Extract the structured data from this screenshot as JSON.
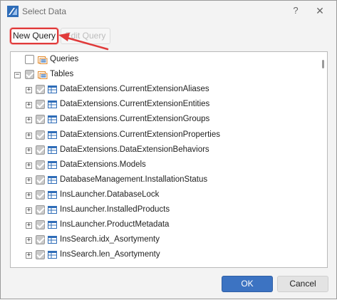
{
  "window": {
    "title": "Select Data",
    "help_glyph": "?",
    "close_glyph": "✕"
  },
  "toolbar": {
    "new_query_label": "New Query",
    "edit_query_label": "Edit Query"
  },
  "tree": {
    "root_items": [
      {
        "label": "Queries",
        "checked": false,
        "icon": "query-folder-icon"
      },
      {
        "label": "Tables",
        "checked": true,
        "icon": "table-folder-icon",
        "expanded": true
      }
    ],
    "tables": [
      {
        "label": "DataExtensions.CurrentExtensionAliases",
        "checked": true
      },
      {
        "label": "DataExtensions.CurrentExtensionEntities",
        "checked": true
      },
      {
        "label": "DataExtensions.CurrentExtensionGroups",
        "checked": true
      },
      {
        "label": "DataExtensions.CurrentExtensionProperties",
        "checked": true
      },
      {
        "label": "DataExtensions.DataExtensionBehaviors",
        "checked": true
      },
      {
        "label": "DataExtensions.Models",
        "checked": true
      },
      {
        "label": "DatabaseManagement.InstallationStatus",
        "checked": true
      },
      {
        "label": "InsLauncher.DatabaseLock",
        "checked": true
      },
      {
        "label": "InsLauncher.InstalledProducts",
        "checked": true
      },
      {
        "label": "InsLauncher.ProductMetadata",
        "checked": true
      },
      {
        "label": "InsSearch.idx_Asortymenty",
        "checked": true
      },
      {
        "label": "InsSearch.len_Asortymenty",
        "checked": true
      }
    ]
  },
  "footer": {
    "ok_label": "OK",
    "cancel_label": "Cancel"
  },
  "colors": {
    "highlight_red": "#e03a3a",
    "primary_blue": "#3c73c2",
    "table_icon_blue": "#2f6db8"
  }
}
